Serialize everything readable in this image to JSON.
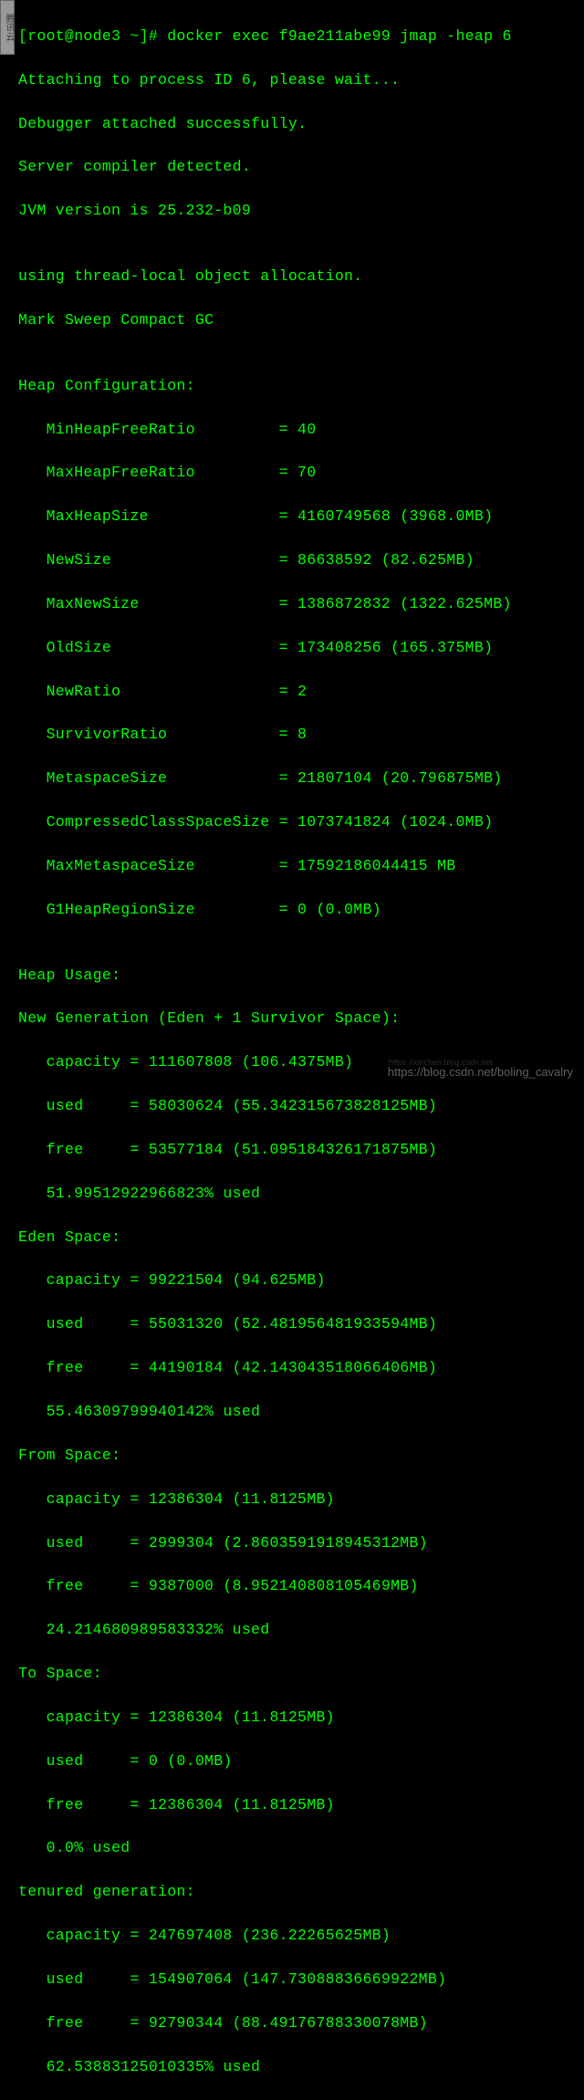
{
  "prompt": "[root@node3 ~]# docker exec f9ae211abe99 jmap -heap 6",
  "attach": "Attaching to process ID 6, please wait...",
  "debugger": "Debugger attached successfully.",
  "server": "Server compiler detected.",
  "jvm": "JVM version is 25.232-b09",
  "blank": "",
  "alloc": "using thread-local object allocation.",
  "gc": "Mark Sweep Compact GC",
  "heapConfigHeader": "Heap Configuration:",
  "config": {
    "l1": "   MinHeapFreeRatio         = 40",
    "l2": "   MaxHeapFreeRatio         = 70",
    "l3": "   MaxHeapSize              = 4160749568 (3968.0MB)",
    "l4": "   NewSize                  = 86638592 (82.625MB)",
    "l5": "   MaxNewSize               = 1386872832 (1322.625MB)",
    "l6": "   OldSize                  = 173408256 (165.375MB)",
    "l7": "   NewRatio                 = 2",
    "l8": "   SurvivorRatio            = 8",
    "l9": "   MetaspaceSize            = 21807104 (20.796875MB)",
    "l10": "   CompressedClassSpaceSize = 1073741824 (1024.0MB)",
    "l11": "   MaxMetaspaceSize         = 17592186044415 MB",
    "l12": "   G1HeapRegionSize         = 0 (0.0MB)"
  },
  "heapUsageHeader": "Heap Usage:",
  "newGenHeader": "New Generation (Eden + 1 Survivor Space):",
  "newGen": {
    "cap": "   capacity = 111607808 (106.4375MB)",
    "used": "   used     = 58030624 (55.342315673828125MB)",
    "free": "   free     = 53577184 (51.095184326171875MB)",
    "pct": "   51.99512922966823% used"
  },
  "edenHeader": "Eden Space:",
  "eden": {
    "cap": "   capacity = 99221504 (94.625MB)",
    "used": "   used     = 55031320 (52.481956481933594MB)",
    "free": "   free     = 44190184 (42.143043518066406MB)",
    "pct": "   55.46309799940142% used"
  },
  "fromHeader": "From Space:",
  "from": {
    "cap": "   capacity = 12386304 (11.8125MB)",
    "used": "   used     = 2999304 (2.8603591918945312MB)",
    "free": "   free     = 9387000 (8.952140808105469MB)",
    "pct": "   24.214680989583332% used"
  },
  "toHeader": "To Space:",
  "to": {
    "cap": "   capacity = 12386304 (11.8125MB)",
    "used": "   used     = 0 (0.0MB)",
    "free": "   free     = 12386304 (11.8125MB)",
    "pct": "   0.0% used"
  },
  "tenuredHeader": "tenured generation:",
  "tenured": {
    "cap": "   capacity = 247697408 (236.22265625MB)",
    "used": "   used     = 154907064 (147.73088836669922MB)",
    "free": "   free     = 92790344 (88.49176788330078MB)",
    "pct": "   62.53883125010335% used"
  },
  "watermark": "https://blog.csdn.net/boling_cavalry",
  "watermark2": "https://xinchen.blog.csdn.net"
}
